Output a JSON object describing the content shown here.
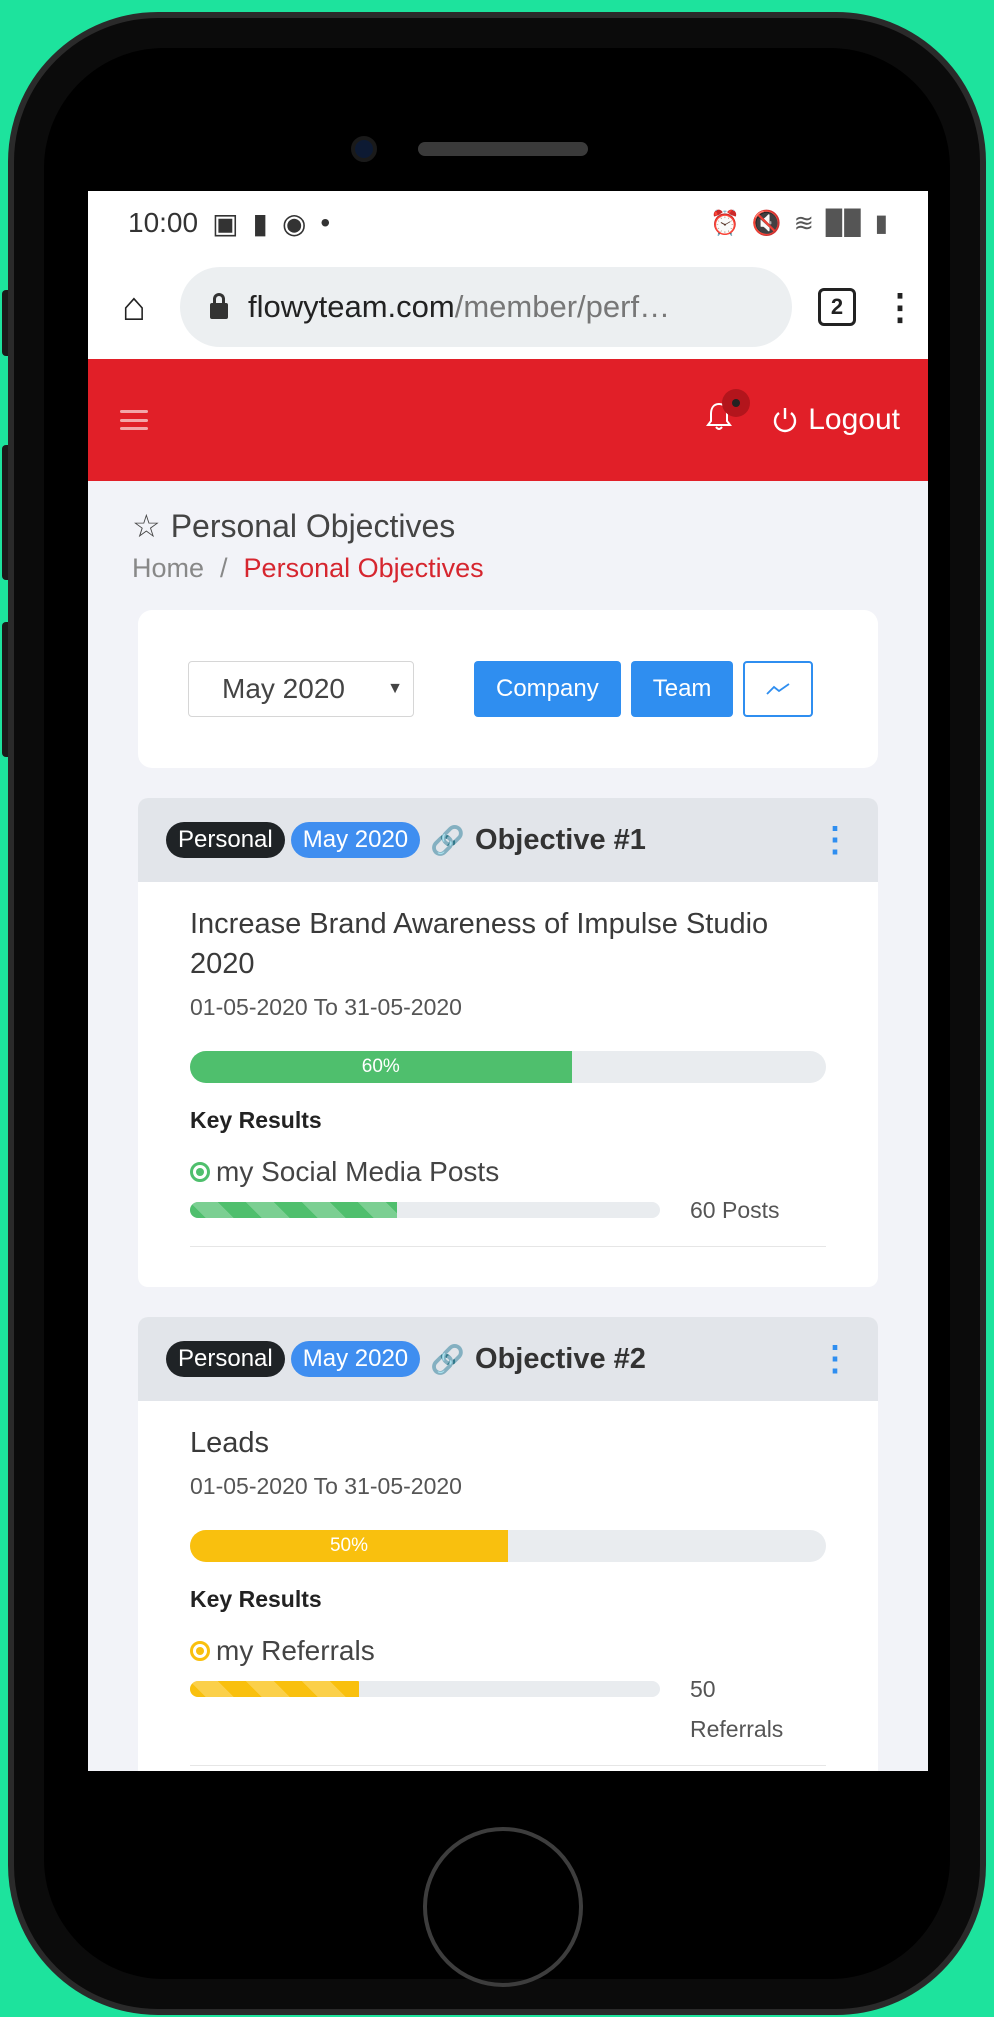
{
  "status_bar": {
    "time": "10:00",
    "left_icons": [
      "image-icon",
      "chat-icon",
      "facebook-icon"
    ],
    "right_icons": [
      "alarm-icon",
      "mute-icon",
      "wifi-icon",
      "signal-icon",
      "battery-icon"
    ]
  },
  "browser": {
    "url_domain": "flowyteam.com",
    "url_path": "/member/perf…",
    "tab_count": "2"
  },
  "header": {
    "logout_label": "Logout",
    "notification_dot": true
  },
  "page": {
    "title": "Personal Objectives",
    "breadcrumb": [
      {
        "label": "Home"
      },
      {
        "label": "Personal Objectives"
      }
    ]
  },
  "filters": {
    "period_value": "May 2020",
    "buttons": [
      {
        "label": "Company"
      },
      {
        "label": "Team"
      }
    ]
  },
  "objectives": [
    {
      "type_badge": "Personal",
      "period_badge": "May 2020",
      "title": "Objective #1",
      "name": "Increase Brand Awareness of Impulse Studio 2020",
      "dates": "01-05-2020 To 31-05-2020",
      "progress_label": "60%",
      "progress": 60,
      "color": "#4fbf6d",
      "key_results_heading": "Key Results",
      "key_results": [
        {
          "name": "my Social Media Posts",
          "value": "60 Posts",
          "progress": 44
        }
      ]
    },
    {
      "type_badge": "Personal",
      "period_badge": "May 2020",
      "title": "Objective #2",
      "name": "Leads",
      "dates": "01-05-2020 To 31-05-2020",
      "progress_label": "50%",
      "progress": 50,
      "color": "#f9c00e",
      "key_results_heading": "Key Results",
      "key_results": [
        {
          "name": "my Referrals",
          "value": "50 Referrals",
          "progress": 36
        }
      ]
    }
  ],
  "colors": {
    "header_red": "#e11f28",
    "primary_blue": "#2f8ef0",
    "success_green": "#4fbf6d",
    "warning_yellow": "#f9c00e",
    "background_green": "#1de39d"
  }
}
